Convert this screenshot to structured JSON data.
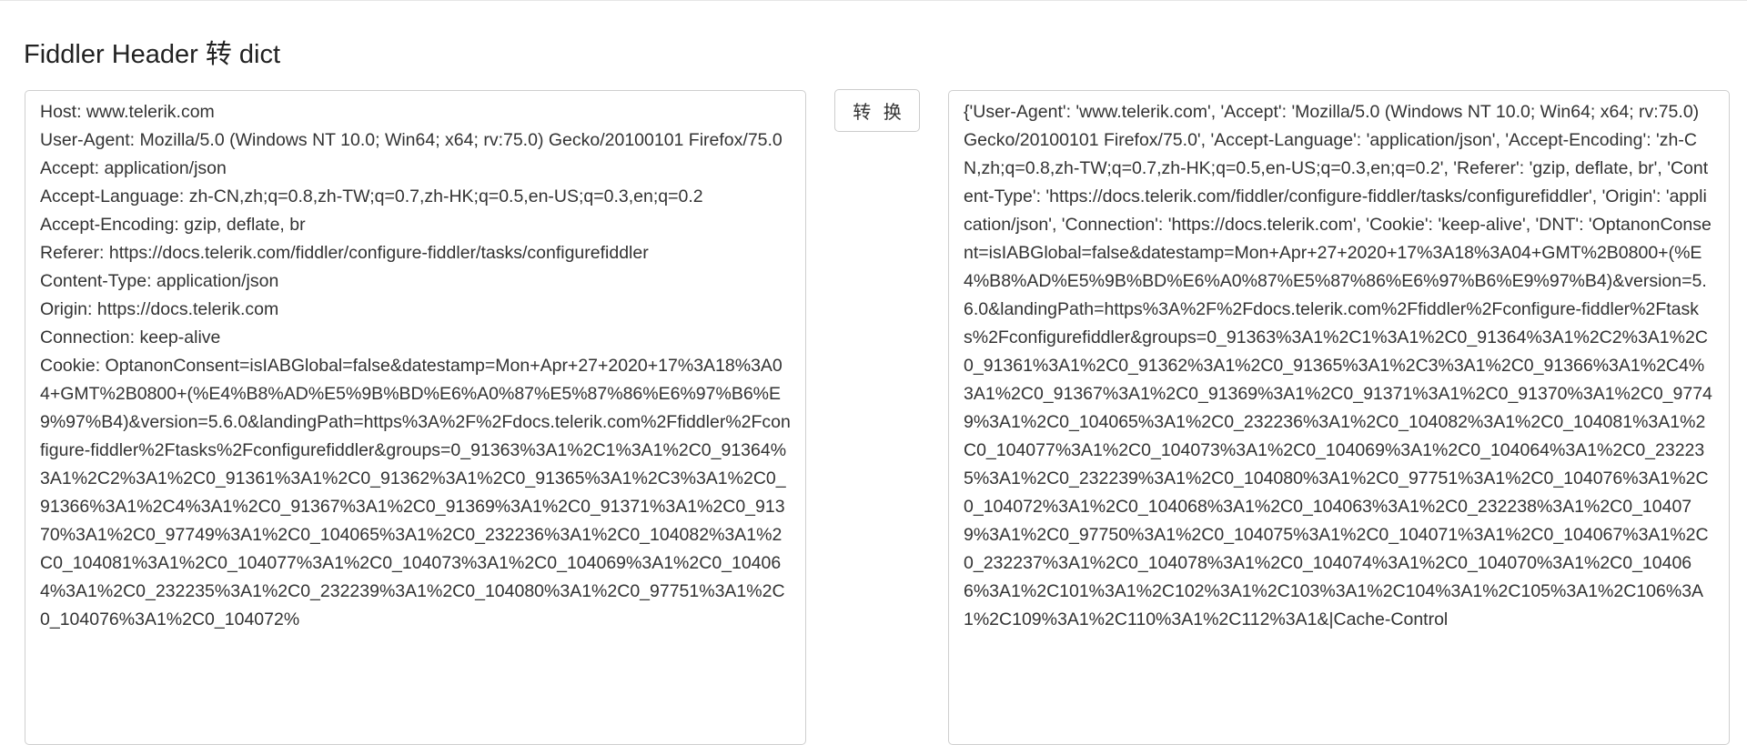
{
  "page": {
    "title": "Fiddler Header 转 dict"
  },
  "convert_button": {
    "label": "转 换"
  },
  "input": {
    "value": "Host: www.telerik.com\nUser-Agent: Mozilla/5.0 (Windows NT 10.0; Win64; x64; rv:75.0) Gecko/20100101 Firefox/75.0\nAccept: application/json\nAccept-Language: zh-CN,zh;q=0.8,zh-TW;q=0.7,zh-HK;q=0.5,en-US;q=0.3,en;q=0.2\nAccept-Encoding: gzip, deflate, br\nReferer: https://docs.telerik.com/fiddler/configure-fiddler/tasks/configurefiddler\nContent-Type: application/json\nOrigin: https://docs.telerik.com\nConnection: keep-alive\nCookie: OptanonConsent=isIABGlobal=false&datestamp=Mon+Apr+27+2020+17%3A18%3A04+GMT%2B0800+(%E4%B8%AD%E5%9B%BD%E6%A0%87%E5%87%86%E6%97%B6%E9%97%B4)&version=5.6.0&landingPath=https%3A%2F%2Fdocs.telerik.com%2Ffiddler%2Fconfigure-fiddler%2Ftasks%2Fconfigurefiddler&groups=0_91363%3A1%2C1%3A1%2C0_91364%3A1%2C2%3A1%2C0_91361%3A1%2C0_91362%3A1%2C0_91365%3A1%2C3%3A1%2C0_91366%3A1%2C4%3A1%2C0_91367%3A1%2C0_91369%3A1%2C0_91371%3A1%2C0_91370%3A1%2C0_97749%3A1%2C0_104065%3A1%2C0_232236%3A1%2C0_104082%3A1%2C0_104081%3A1%2C0_104077%3A1%2C0_104073%3A1%2C0_104069%3A1%2C0_104064%3A1%2C0_232235%3A1%2C0_232239%3A1%2C0_104080%3A1%2C0_97751%3A1%2C0_104076%3A1%2C0_104072%"
  },
  "output": {
    "value": "{'User-Agent': 'www.telerik.com', 'Accept': 'Mozilla/5.0 (Windows NT 10.0; Win64; x64; rv:75.0) Gecko/20100101 Firefox/75.0', 'Accept-Language': 'application/json', 'Accept-Encoding': 'zh-CN,zh;q=0.8,zh-TW;q=0.7,zh-HK;q=0.5,en-US;q=0.3,en;q=0.2', 'Referer': 'gzip, deflate, br', 'Content-Type': 'https://docs.telerik.com/fiddler/configure-fiddler/tasks/configurefiddler', 'Origin': 'application/json', 'Connection': 'https://docs.telerik.com', 'Cookie': 'keep-alive', 'DNT': 'OptanonConsent=isIABGlobal=false&datestamp=Mon+Apr+27+2020+17%3A18%3A04+GMT%2B0800+(%E4%B8%AD%E5%9B%BD%E6%A0%87%E5%87%86%E6%97%B6%E9%97%B4)&version=5.6.0&landingPath=https%3A%2F%2Fdocs.telerik.com%2Ffiddler%2Fconfigure-fiddler%2Ftasks%2Fconfigurefiddler&groups=0_91363%3A1%2C1%3A1%2C0_91364%3A1%2C2%3A1%2C0_91361%3A1%2C0_91362%3A1%2C0_91365%3A1%2C3%3A1%2C0_91366%3A1%2C4%3A1%2C0_91367%3A1%2C0_91369%3A1%2C0_91371%3A1%2C0_91370%3A1%2C0_97749%3A1%2C0_104065%3A1%2C0_232236%3A1%2C0_104082%3A1%2C0_104081%3A1%2C0_104077%3A1%2C0_104073%3A1%2C0_104069%3A1%2C0_104064%3A1%2C0_232235%3A1%2C0_232239%3A1%2C0_104080%3A1%2C0_97751%3A1%2C0_104076%3A1%2C0_104072%3A1%2C0_104068%3A1%2C0_104063%3A1%2C0_232238%3A1%2C0_104079%3A1%2C0_97750%3A1%2C0_104075%3A1%2C0_104071%3A1%2C0_104067%3A1%2C0_232237%3A1%2C0_104078%3A1%2C0_104074%3A1%2C0_104070%3A1%2C0_104066%3A1%2C101%3A1%2C102%3A1%2C103%3A1%2C104%3A1%2C105%3A1%2C106%3A1%2C109%3A1%2C110%3A1%2C112%3A1&|Cache-Control"
  }
}
